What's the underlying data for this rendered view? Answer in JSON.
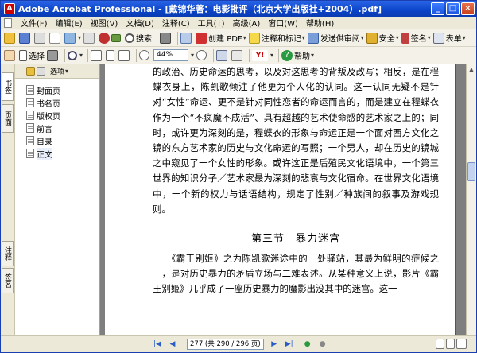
{
  "window": {
    "title": "Adobe Acrobat Professional - [戴锦华著：电影批评（北京大学出版社+2004）.pdf]",
    "app_icon": "acrobat-icon"
  },
  "menu": [
    "文件(F)",
    "编辑(E)",
    "视图(V)",
    "文档(D)",
    "注释(C)",
    "工具(T)",
    "高级(A)",
    "窗口(W)",
    "帮助(H)"
  ],
  "toolbar1": {
    "search_label": "搜索",
    "create_pdf_label": "创建 PDF",
    "organize_label": "注释和标记",
    "send_review_label": "发送供审阅",
    "secure_label": "安全",
    "sign_label": "签名",
    "forms_label": "表单"
  },
  "toolbar2": {
    "select_label": "选择",
    "zoom_value": "44%",
    "help_label": "帮助"
  },
  "sidebar_tabs": [
    "书签",
    "页面",
    "注释",
    "签名"
  ],
  "bookmarks": {
    "options_label": "选项",
    "items": [
      "封面页",
      "书名页",
      "版权页",
      "前言",
      "目录",
      "正文"
    ]
  },
  "document": {
    "paragraph1": "的政治、历史命运的思考，以及对这思考的背叛及改写；相反，是在程蝶衣身上，陈凯歌倾注了他更为个人化的认同。这一认同无疑不是针对“女性”命运、更不是针对同性恋者的命运而言的，而是建立在程蝶衣作为一个“不疯魔不成活”、具有超越的艺术使命感的艺术家之上的；同时，或许更为深刻的是，程蝶衣的形象与命运正是一个面对西方文化之镜的东方艺术家的历史与文化命运的写照；一个男人，却在历史的镜城之中窥见了一个女性的形象。或许这正是后殖民文化语境中，一个第三世界的知识分子／艺术家最为深刻的悲哀与文化宿命。在世界文化语境中，一个新的权力与话语结构，规定了性别／种族间的叙事及游戏规则。",
    "section_title": "第三节　暴力迷宫",
    "paragraph2": "　　《霸王别姬》之为陈凯歌迷途中的一处驿站，其最为鲜明的症候之一，是对历史暴力的矛盾立场与二难表述。从某种意义上说，影片《霸王别姬》几乎成了一座历史暴力的魔影出没其中的迷宫。这一"
  },
  "status": {
    "page_indicator": "277 (共 290 / 296 页)"
  }
}
